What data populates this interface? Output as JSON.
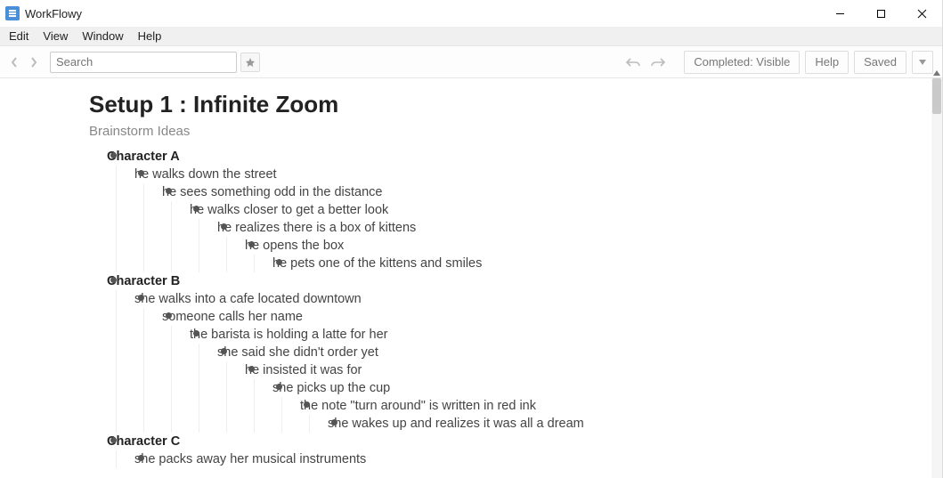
{
  "app": {
    "title": "WorkFlowy"
  },
  "menu": {
    "edit": "Edit",
    "view": "View",
    "window": "Window",
    "help": "Help"
  },
  "toolbar": {
    "search_placeholder": "Search",
    "completed_label": "Completed: Visible",
    "help_label": "Help",
    "saved_label": "Saved"
  },
  "doc": {
    "title": "Setup 1 : Infinite Zoom",
    "subtitle": "Brainstorm Ideas"
  },
  "outline": [
    {
      "text": "Character A",
      "bold": true,
      "children": [
        {
          "text": "he walks down the street",
          "children": [
            {
              "text": "he sees something odd in the distance",
              "children": [
                {
                  "text": "he walks closer to get a better look",
                  "children": [
                    {
                      "text": "he realizes there is a box of kittens",
                      "children": [
                        {
                          "text": "he opens the box",
                          "children": [
                            {
                              "text": "he pets one of the kittens and smiles",
                              "children": []
                            }
                          ]
                        }
                      ]
                    }
                  ]
                }
              ]
            }
          ]
        }
      ]
    },
    {
      "text": "Character B",
      "bold": true,
      "children": [
        {
          "text": "she walks into a cafe located downtown",
          "children": [
            {
              "text": "someone calls her name",
              "children": [
                {
                  "text": "the barista is holding a latte for her",
                  "children": [
                    {
                      "text": "she said she didn't order yet",
                      "children": [
                        {
                          "text": "he insisted it was for",
                          "children": [
                            {
                              "text": "she picks up the cup",
                              "children": [
                                {
                                  "text": "the note \"turn around\" is written in red ink",
                                  "children": [
                                    {
                                      "text": "she wakes up and realizes it was all a dream",
                                      "children": []
                                    }
                                  ]
                                }
                              ]
                            }
                          ]
                        }
                      ]
                    }
                  ]
                }
              ]
            }
          ]
        }
      ]
    },
    {
      "text": "Character C",
      "bold": true,
      "children": [
        {
          "text": "she packs away her musical instruments",
          "children": []
        }
      ]
    }
  ]
}
